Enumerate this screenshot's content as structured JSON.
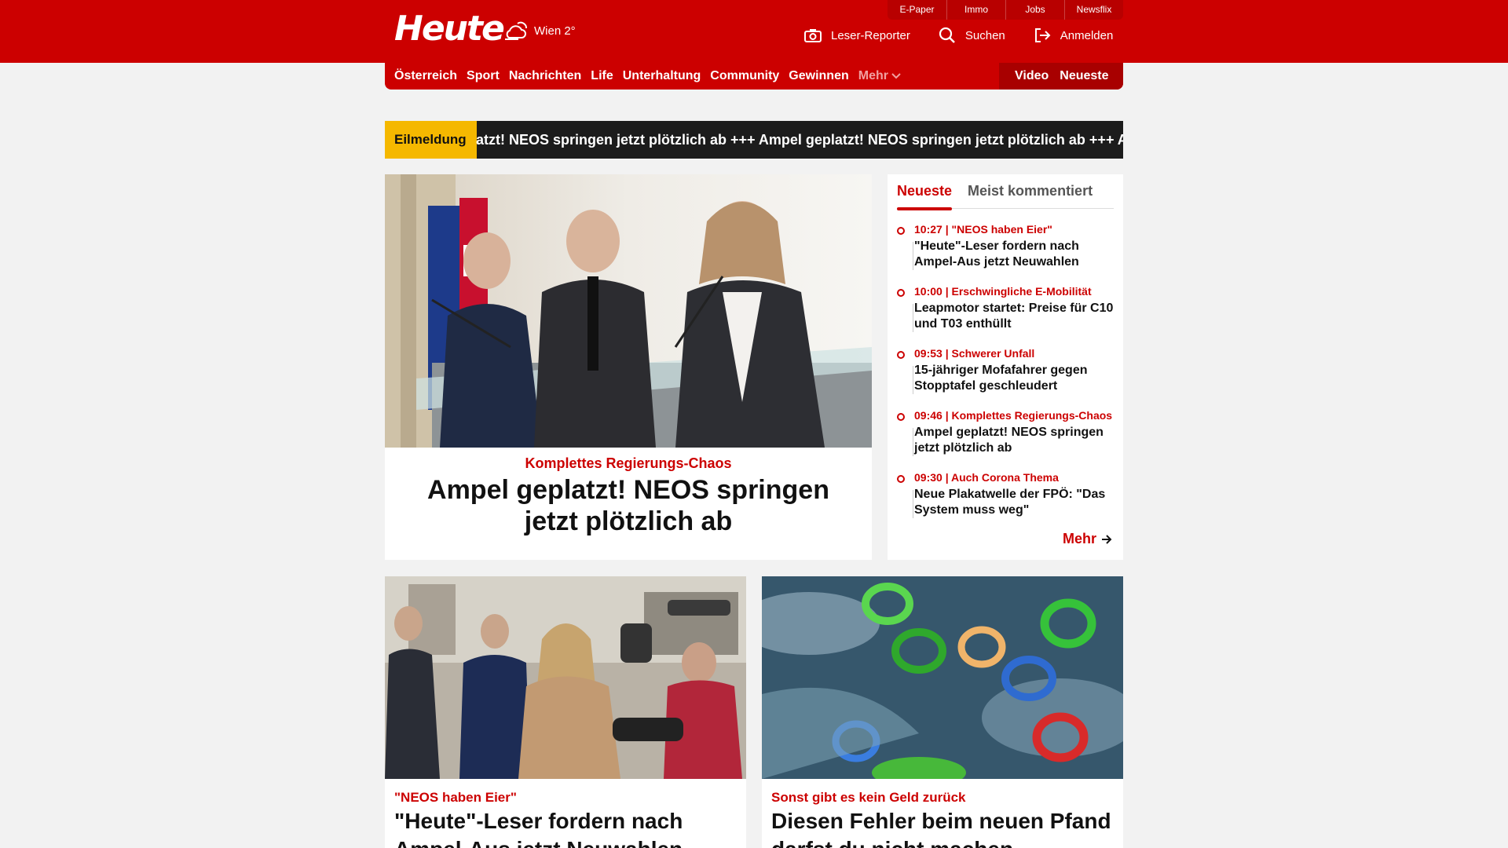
{
  "header": {
    "logo": "Heute",
    "weather_icon": "cloud-sun-icon",
    "weather_text": "Wien 2°",
    "topbar": [
      "E-Paper",
      "Immo",
      "Jobs",
      "Newsflix"
    ],
    "actions": [
      {
        "icon": "camera-icon",
        "label": "Leser-Reporter"
      },
      {
        "icon": "search-icon",
        "label": "Suchen"
      },
      {
        "icon": "login-icon",
        "label": "Anmelden"
      }
    ],
    "brand_color": "#cc0000"
  },
  "nav": {
    "items": [
      "Österreich",
      "Sport",
      "Nachrichten",
      "Life",
      "Unterhaltung",
      "Community",
      "Gewinnen"
    ],
    "more": "Mehr",
    "right": [
      "Video",
      "Neueste"
    ]
  },
  "ticker": {
    "label": "Eilmeldung",
    "text": "atzt! NEOS springen jetzt plötzlich ab  +++  Ampel geplatzt! NEOS springen jetzt plötzlich ab  +++  A"
  },
  "hero": {
    "kicker": "Komplettes Regierungs-Chaos",
    "title": "Ampel geplatzt! NEOS springen jetzt plötzlich ab"
  },
  "sidebar": {
    "tabs": [
      "Neueste",
      "Meist kommentiert"
    ],
    "items": [
      {
        "meta": "10:27 | \"NEOS haben Eier\"",
        "title": "\"Heute\"-Leser fordern nach Ampel-Aus jetzt Neuwahlen"
      },
      {
        "meta": "10:00 | Erschwingliche E-Mobilität",
        "title": "Leapmotor startet: Preise für C10 und T03 enthüllt"
      },
      {
        "meta": "09:53 | Schwerer Unfall",
        "title": "15-jähriger Mofafahrer gegen Stopptafel geschleudert"
      },
      {
        "meta": "09:46 | Komplettes Regierungs-Chaos",
        "title": "Ampel geplatzt! NEOS springen jetzt plötzlich ab"
      },
      {
        "meta": "09:30 | Auch Corona Thema",
        "title": "Neue Plakatwelle der FPÖ: \"Das System muss weg\""
      }
    ],
    "more": "Mehr"
  },
  "cards": [
    {
      "kicker": "\"NEOS haben Eier\"",
      "title": "\"Heute\"-Leser fordern nach Ampel-Aus jetzt Neuwahlen"
    },
    {
      "kicker": "Sonst gibt es kein Geld zurück",
      "title": "Diesen Fehler beim neuen Pfand darfst du nicht machen"
    }
  ]
}
